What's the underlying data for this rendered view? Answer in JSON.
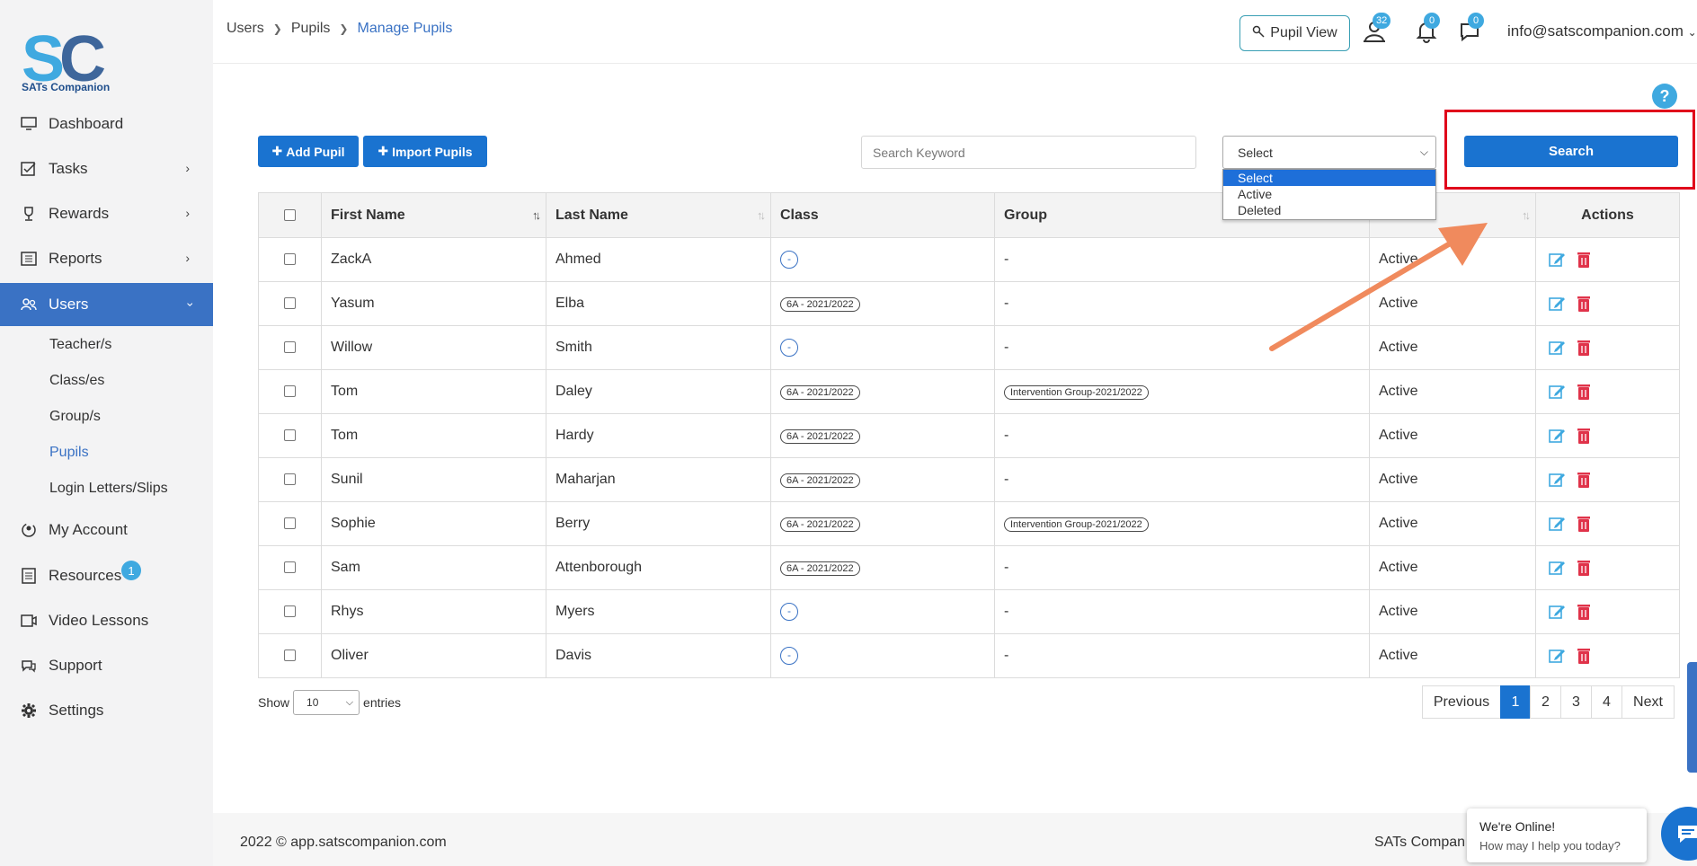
{
  "brand": {
    "logo_text": "SATs Companion"
  },
  "sidebar": {
    "items": [
      {
        "label": "Dashboard",
        "icon": "monitor-icon"
      },
      {
        "label": "Tasks",
        "icon": "tasks-icon"
      },
      {
        "label": "Rewards",
        "icon": "trophy-icon"
      },
      {
        "label": "Reports",
        "icon": "reports-icon"
      },
      {
        "label": "Users",
        "icon": "users-icon"
      },
      {
        "label": "My Account",
        "icon": "account-icon"
      },
      {
        "label": "Resources",
        "icon": "resources-icon",
        "badge": "1"
      },
      {
        "label": "Video Lessons",
        "icon": "video-icon"
      },
      {
        "label": "Support",
        "icon": "support-icon"
      },
      {
        "label": "Settings",
        "icon": "gear-icon"
      }
    ],
    "sub_items": [
      "Teacher/s",
      "Class/es",
      "Group/s",
      "Pupils",
      "Login Letters/Slips"
    ]
  },
  "breadcrumb": {
    "items": [
      "Users",
      "Pupils"
    ],
    "current": "Manage Pupils"
  },
  "header": {
    "pupil_view_label": "Pupil View",
    "users_badge": "32",
    "notifications_badge": "0",
    "messages_badge": "0",
    "account_email": "info@satscompanion.com"
  },
  "toolbar": {
    "add_pupil_label": "Add Pupil",
    "import_pupils_label": "Import Pupils",
    "search_placeholder": "Search Keyword",
    "status_select_value": "Select",
    "status_options": [
      "Select",
      "Active",
      "Deleted"
    ],
    "search_button_label": "Search"
  },
  "table": {
    "columns": [
      "First Name",
      "Last Name",
      "Class",
      "Group",
      "",
      "Actions"
    ],
    "rows": [
      {
        "first": "ZackA",
        "last": "Ahmed",
        "class": "-",
        "group": "-",
        "status": "Active"
      },
      {
        "first": "Yasum",
        "last": "Elba",
        "class": "6A - 2021/2022",
        "group": "-",
        "status": "Active"
      },
      {
        "first": "Willow",
        "last": "Smith",
        "class": "-",
        "group": "-",
        "status": "Active"
      },
      {
        "first": "Tom",
        "last": "Daley",
        "class": "6A - 2021/2022",
        "group": "Intervention Group-2021/2022",
        "status": "Active"
      },
      {
        "first": "Tom",
        "last": "Hardy",
        "class": "6A - 2021/2022",
        "group": "-",
        "status": "Active"
      },
      {
        "first": "Sunil",
        "last": "Maharjan",
        "class": "6A - 2021/2022",
        "group": "-",
        "status": "Active"
      },
      {
        "first": "Sophie",
        "last": "Berry",
        "class": "6A - 2021/2022",
        "group": "Intervention Group-2021/2022",
        "status": "Active"
      },
      {
        "first": "Sam",
        "last": "Attenborough",
        "class": "6A - 2021/2022",
        "group": "-",
        "status": "Active"
      },
      {
        "first": "Rhys",
        "last": "Myers",
        "class": "-",
        "group": "-",
        "status": "Active"
      },
      {
        "first": "Oliver",
        "last": "Davis",
        "class": "-",
        "group": "-",
        "status": "Active"
      }
    ]
  },
  "pagination": {
    "show_label": "Show",
    "entries_value": "10",
    "entries_label": "entries",
    "previous": "Previous",
    "pages": [
      "1",
      "2",
      "3",
      "4"
    ],
    "current_page": "1",
    "next": "Next"
  },
  "footer": {
    "copyright": "2022 © app.satscompanion.com",
    "right_text": "SATs Compan"
  },
  "chat": {
    "title": "We're Online!",
    "subtitle": "How may I help you today?"
  },
  "colors": {
    "primary": "#1a73d0",
    "sidebar_active": "#3a72c4",
    "highlight_box": "#e0001b",
    "arrow": "#f08a5d",
    "delete": "#e0334a"
  }
}
